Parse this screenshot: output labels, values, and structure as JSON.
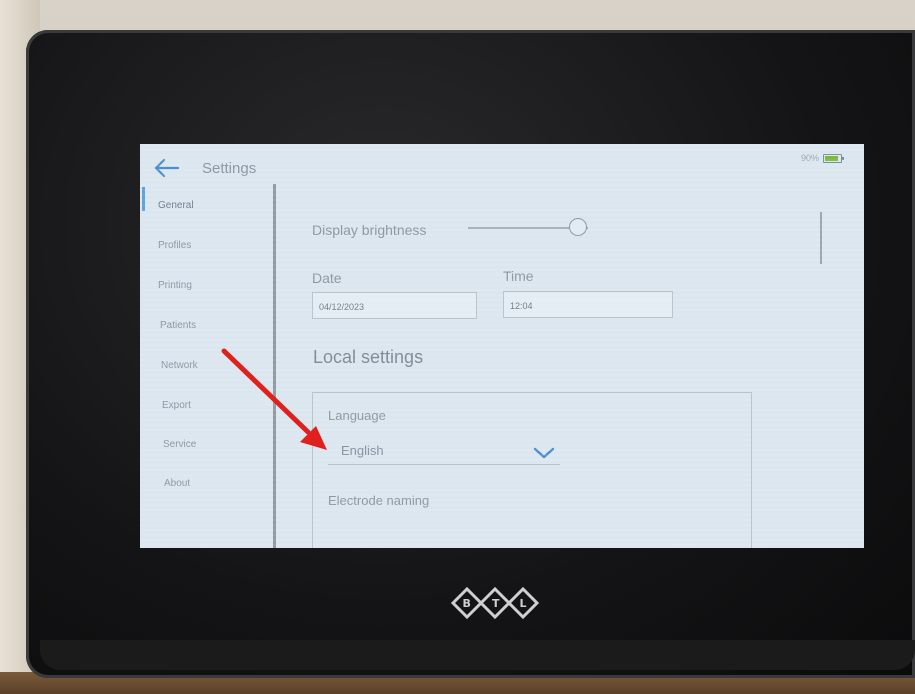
{
  "header": {
    "title": "Settings",
    "battery_percent": "90%",
    "battery_level": 0.9
  },
  "sidebar": {
    "items": [
      {
        "label": "General",
        "active": true
      },
      {
        "label": "Profiles"
      },
      {
        "label": "Printing"
      },
      {
        "label": "Patients"
      },
      {
        "label": "Network"
      },
      {
        "label": "Export"
      },
      {
        "label": "Service"
      },
      {
        "label": "About"
      }
    ]
  },
  "display": {
    "brightness_label": "Display brightness",
    "brightness_level": 0.92
  },
  "datetime": {
    "date_label": "Date",
    "date_value": "04/12/2023",
    "time_label": "Time",
    "time_value": "12:04"
  },
  "local_settings": {
    "heading": "Local settings",
    "language_label": "Language",
    "language_value": "English",
    "electrode_label": "Electrode naming"
  },
  "colors": {
    "accent": "#5aa3e0",
    "annotation_arrow": "#e0201c",
    "battery_fill": "#77bd3a"
  }
}
